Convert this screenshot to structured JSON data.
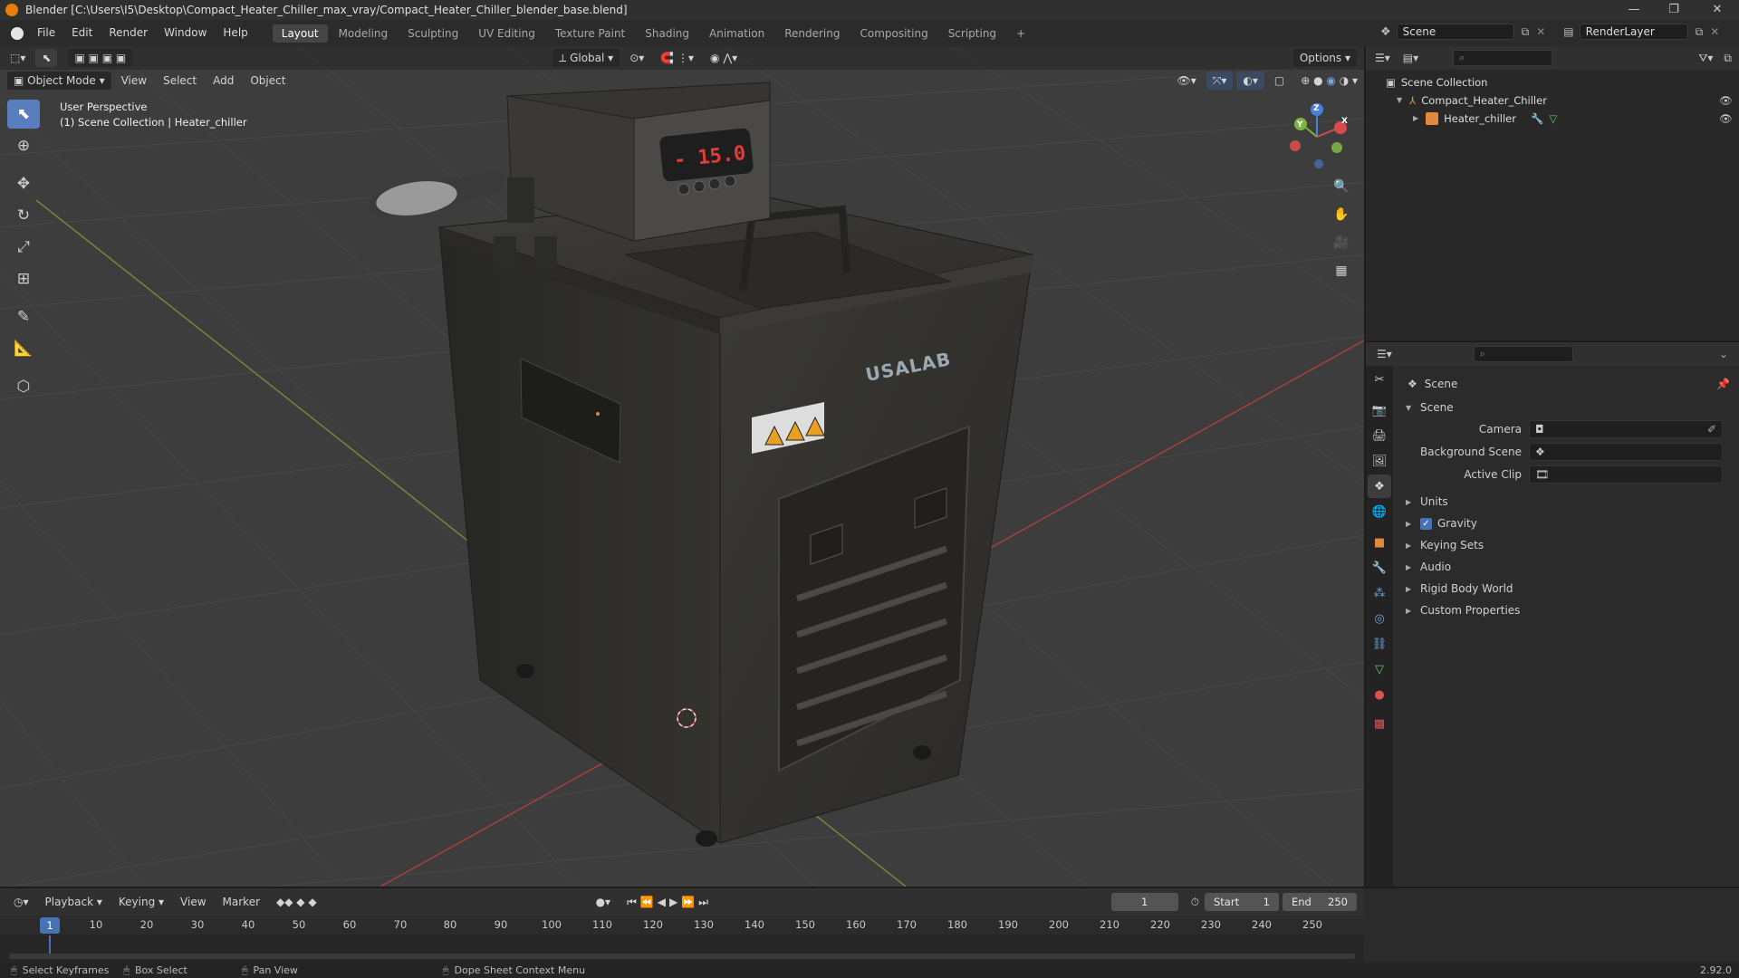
{
  "titlebar": {
    "title": "Blender [C:\\Users\\I5\\Desktop\\Compact_Heater_Chiller_max_vray/Compact_Heater_Chiller_blender_base.blend]",
    "minimize": "—",
    "maximize": "❐",
    "close": "✕"
  },
  "menubar": {
    "menus": [
      "File",
      "Edit",
      "Render",
      "Window",
      "Help"
    ],
    "workspaces": [
      "Layout",
      "Modeling",
      "Sculpting",
      "UV Editing",
      "Texture Paint",
      "Shading",
      "Animation",
      "Rendering",
      "Compositing",
      "Scripting"
    ],
    "active_workspace": "Layout",
    "add_workspace": "+",
    "scene_name": "Scene",
    "view_layer": "RenderLayer"
  },
  "viewport": {
    "orientation": "Global",
    "options": "Options",
    "mode": "Object Mode",
    "menus": [
      "View",
      "Select",
      "Add",
      "Object"
    ],
    "perspective": "User Perspective",
    "collection_info": "(1) Scene Collection | Heater_chiller",
    "display_readout": "- 15.0",
    "brand": "USALAB",
    "gizmo_axes": [
      "X",
      "Y",
      "Z"
    ]
  },
  "outliner": {
    "root": "Scene Collection",
    "collection": "Compact_Heater_Chiller",
    "object": "Heater_chiller"
  },
  "properties": {
    "header": "Scene",
    "section": "Scene",
    "fields": {
      "camera": "Camera",
      "background_scene": "Background Scene",
      "active_clip": "Active Clip"
    },
    "panels": [
      "Units",
      "Gravity",
      "Keying Sets",
      "Audio",
      "Rigid Body World",
      "Custom Properties"
    ],
    "gravity_checked": true
  },
  "timeline": {
    "menus": [
      "Playback",
      "Keying",
      "View",
      "Marker"
    ],
    "current_frame": "1",
    "start_label": "Start",
    "start": "1",
    "end_label": "End",
    "end": "250",
    "ticks": [
      "10",
      "20",
      "30",
      "40",
      "50",
      "60",
      "70",
      "80",
      "90",
      "100",
      "110",
      "120",
      "130",
      "140",
      "150",
      "160",
      "170",
      "180",
      "190",
      "200",
      "210",
      "220",
      "230",
      "240",
      "250"
    ],
    "playhead": "1"
  },
  "statusbar": {
    "items": [
      "Select Keyframes",
      "Box Select",
      "Pan View",
      "Dope Sheet Context Menu"
    ],
    "version": "2.92.0"
  },
  "colors": {
    "accent": "#4772b3",
    "axis_x": "#d94a4a",
    "axis_y": "#7cb342",
    "axis_z": "#4a7fd9",
    "brand_orange": "#e87d0d"
  }
}
